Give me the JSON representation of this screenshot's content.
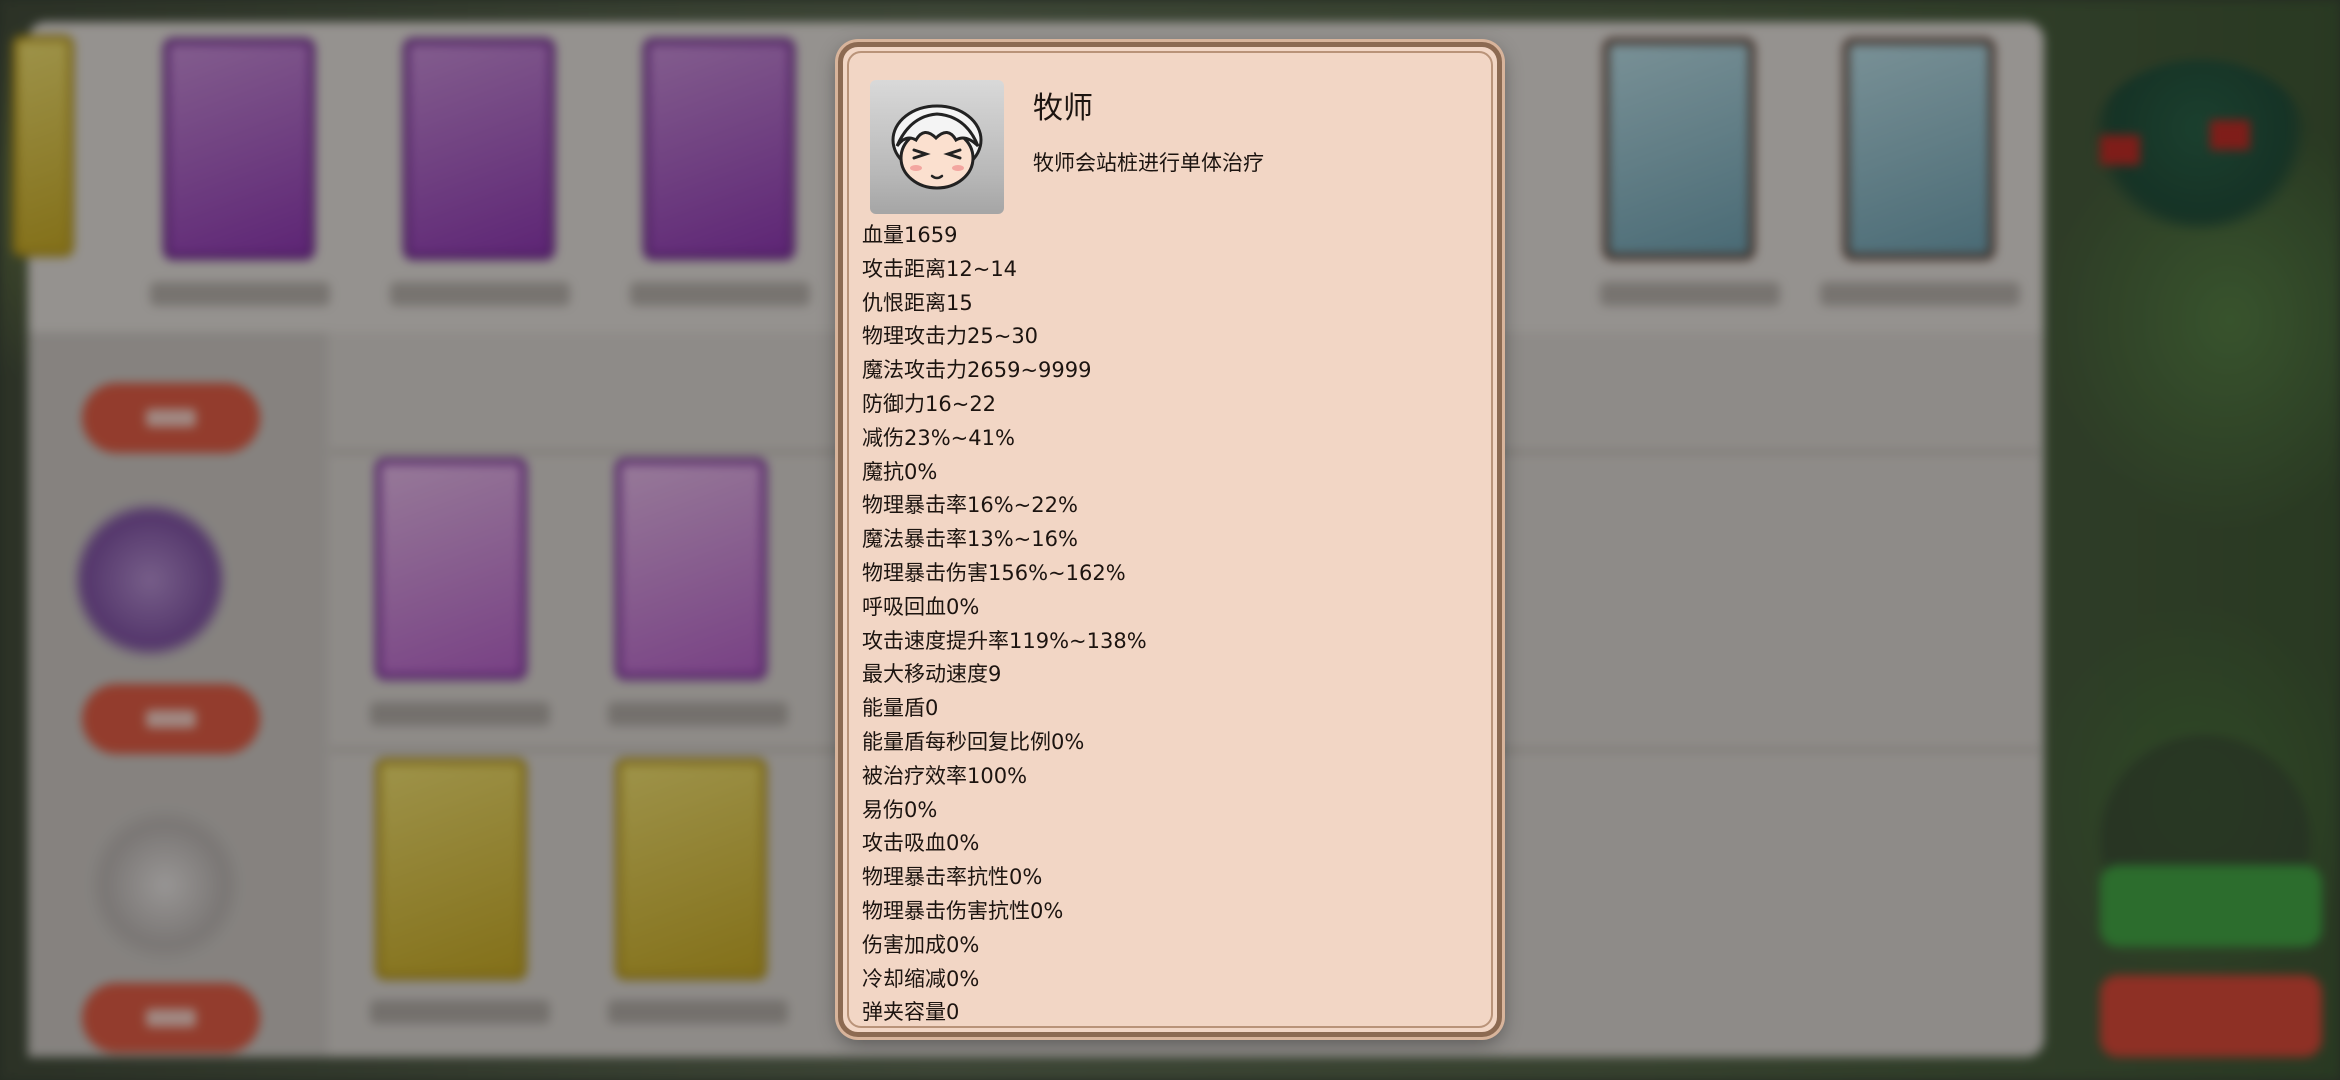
{
  "popup": {
    "name": "牧师",
    "description": "牧师会站桩进行单体治疗",
    "portrait_icon": "priest-portrait-icon",
    "stats": [
      "血量1659",
      "攻击距离12~14",
      "仇恨距离15",
      "物理攻击力25~30",
      "魔法攻击力2659~9999",
      "防御力16~22",
      "减伤23%~41%",
      "魔抗0%",
      "物理暴击率16%~22%",
      "魔法暴击率13%~16%",
      "物理暴击伤害156%~162%",
      "呼吸回血0%",
      "攻击速度提升率119%~138%",
      "最大移动速度9",
      "能量盾0",
      "能量盾每秒回复比例0%",
      "被治疗效率100%",
      "易伤0%",
      "攻击吸血0%",
      "物理暴击率抗性0%",
      "物理暴击伤害抗性0%",
      "伤害加成0%",
      "冷却缩减0%",
      "弹夹容量0"
    ]
  },
  "colors": {
    "popup_bg": "#f2d6c5",
    "popup_border": "#8c6a52",
    "text": "#1c1410"
  }
}
